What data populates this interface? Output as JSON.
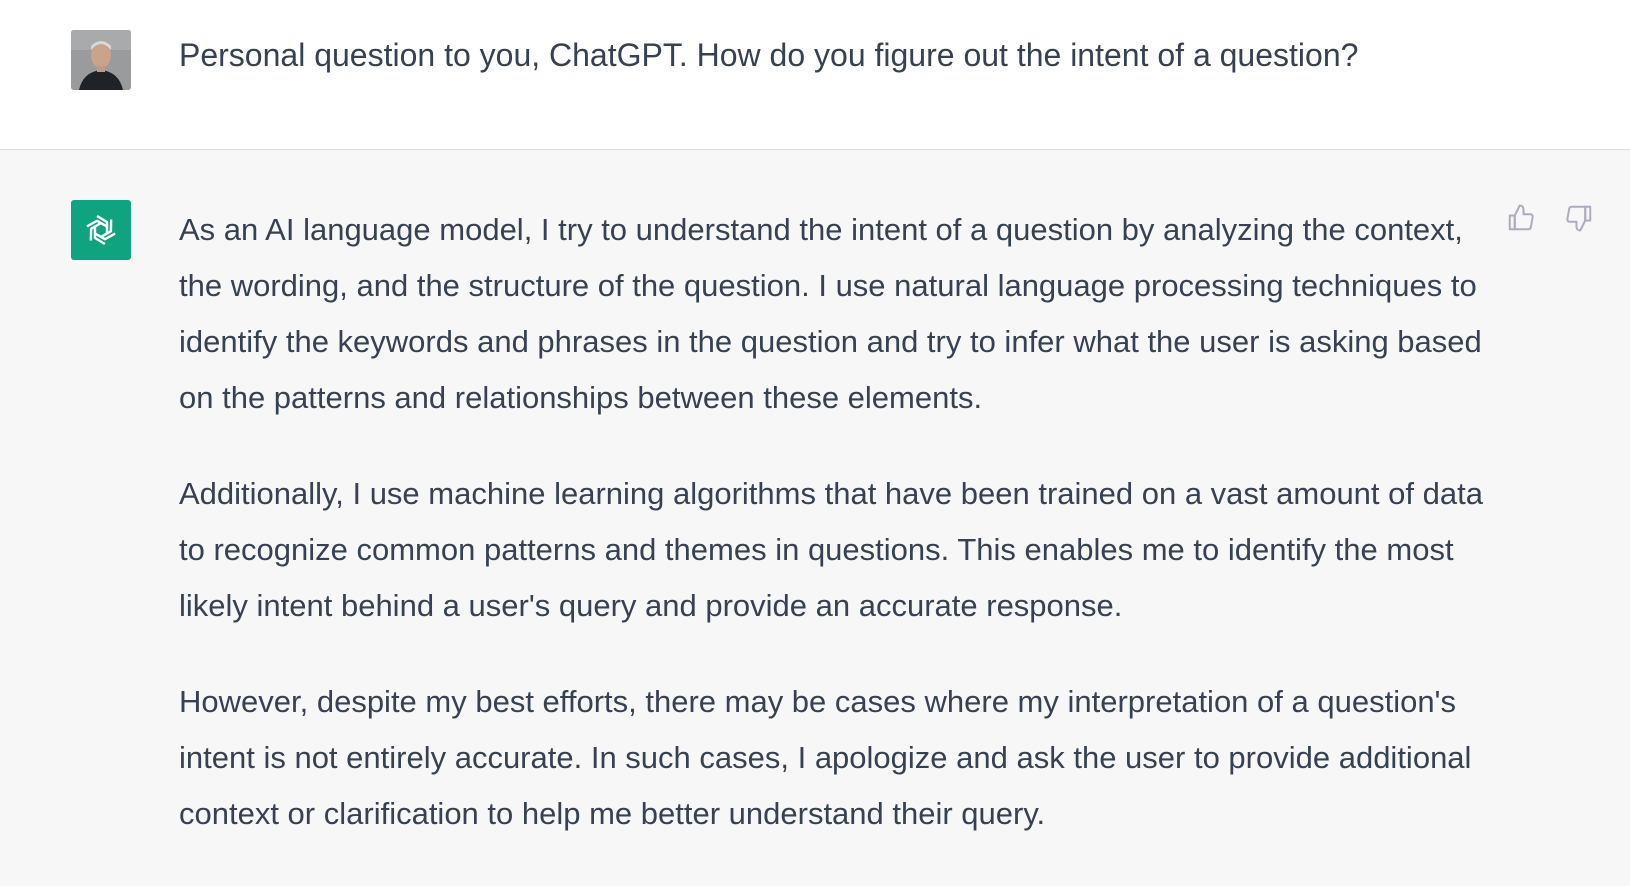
{
  "conversation": {
    "user_message": {
      "avatar": "user-photo",
      "text": "Personal question to you, ChatGPT. How do you figure out the intent of a question?"
    },
    "assistant_message": {
      "avatar": "chatgpt-logo-icon",
      "paragraphs": [
        "As an AI language model, I try to understand the intent of a question by analyzing the context, the wording, and the structure of the question. I use natural language processing techniques to identify the keywords and phrases in the question and try to infer what the user is asking based on the patterns and relationships between these elements.",
        "Additionally, I use machine learning algorithms that have been trained on a vast amount of data to recognize common patterns and themes in questions. This enables me to identify the most likely intent behind a user's query and provide an accurate response.",
        "However, despite my best efforts, there may be cases where my interpretation of a question's intent is not entirely accurate. In such cases, I apologize and ask the user to provide additional context or clarification to help me better understand their query."
      ],
      "feedback_icons": [
        "thumbs-up-icon",
        "thumbs-down-icon"
      ]
    }
  },
  "colors": {
    "user_bg": "#ffffff",
    "assistant_bg": "#f7f7f8",
    "text": "#374151",
    "brand_green": "#10a37f",
    "icon_gray": "#acacbe"
  }
}
